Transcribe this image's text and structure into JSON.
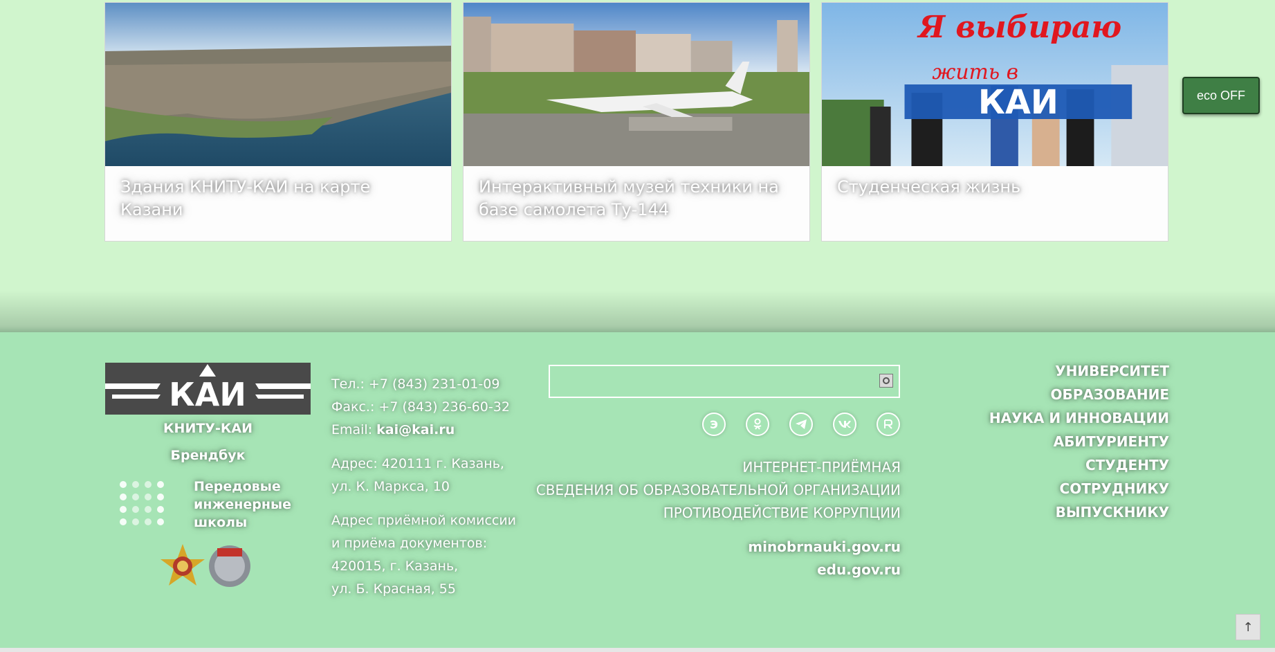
{
  "cards": [
    {
      "title": "Здания КНИТУ-КАИ на карте Казани"
    },
    {
      "title": "Интерактивный музей техники на базе самолета Ту-144"
    },
    {
      "title": "Студенческая жизнь",
      "image_text_1": "Я выбираю",
      "image_text_2": "жить в",
      "image_logo": "КАИ"
    }
  ],
  "eco_button": "eco OFF",
  "footer": {
    "logo_text": "КАИ",
    "brand_name": "КНИТУ-КАИ",
    "brandbook": "Брендбук",
    "pish_lines": [
      "Передовые",
      "инженерные",
      "школы"
    ],
    "phone": "Тел.: +7 (843) 231-01-09",
    "fax": "Факс.: +7 (843) 236-60-32",
    "email_label": "Email:",
    "email": "kai@kai.ru",
    "address_lines": [
      "Адрес: 420111 г. Казань,",
      "ул. К. Маркса, 10"
    ],
    "admission_lines": [
      "Адрес приёмной комиссии",
      "и приёма документов:",
      "420015, г. Казань,",
      "ул. Б. Красная, 55"
    ],
    "search_placeholder": "",
    "socials": [
      {
        "icon": "e-icon",
        "glyph": "Э"
      },
      {
        "icon": "odnoklassniki-icon",
        "glyph": ""
      },
      {
        "icon": "telegram-icon",
        "glyph": ""
      },
      {
        "icon": "vk-icon",
        "glyph": ""
      },
      {
        "icon": "rutube-icon",
        "glyph": ""
      }
    ],
    "links": [
      "ИНТЕРНЕТ-ПРИЁМНАЯ",
      "СВЕДЕНИЯ ОБ ОБРАЗОВАТЕЛЬНОЙ ОРГАНИЗАЦИИ",
      "ПРОТИВОДЕЙСТВИЕ КОРРУПЦИИ"
    ],
    "sites": [
      "minobrnauki.gov.ru",
      "edu.gov.ru"
    ],
    "nav": [
      "УНИВЕРСИТЕТ",
      "ОБРАЗОВАНИЕ",
      "НАУКА И ИННОВАЦИИ",
      "АБИТУРИЕНТУ",
      "СТУДЕНТУ",
      "СОТРУДНИКУ",
      "ВЫПУСКНИКУ"
    ],
    "to_top": "↑"
  },
  "colors": {
    "page_bg": "#d0f5cd",
    "footer_bg": "#a6e4b5",
    "eco_button": "#3f7f45",
    "logo_bg": "#494949"
  }
}
